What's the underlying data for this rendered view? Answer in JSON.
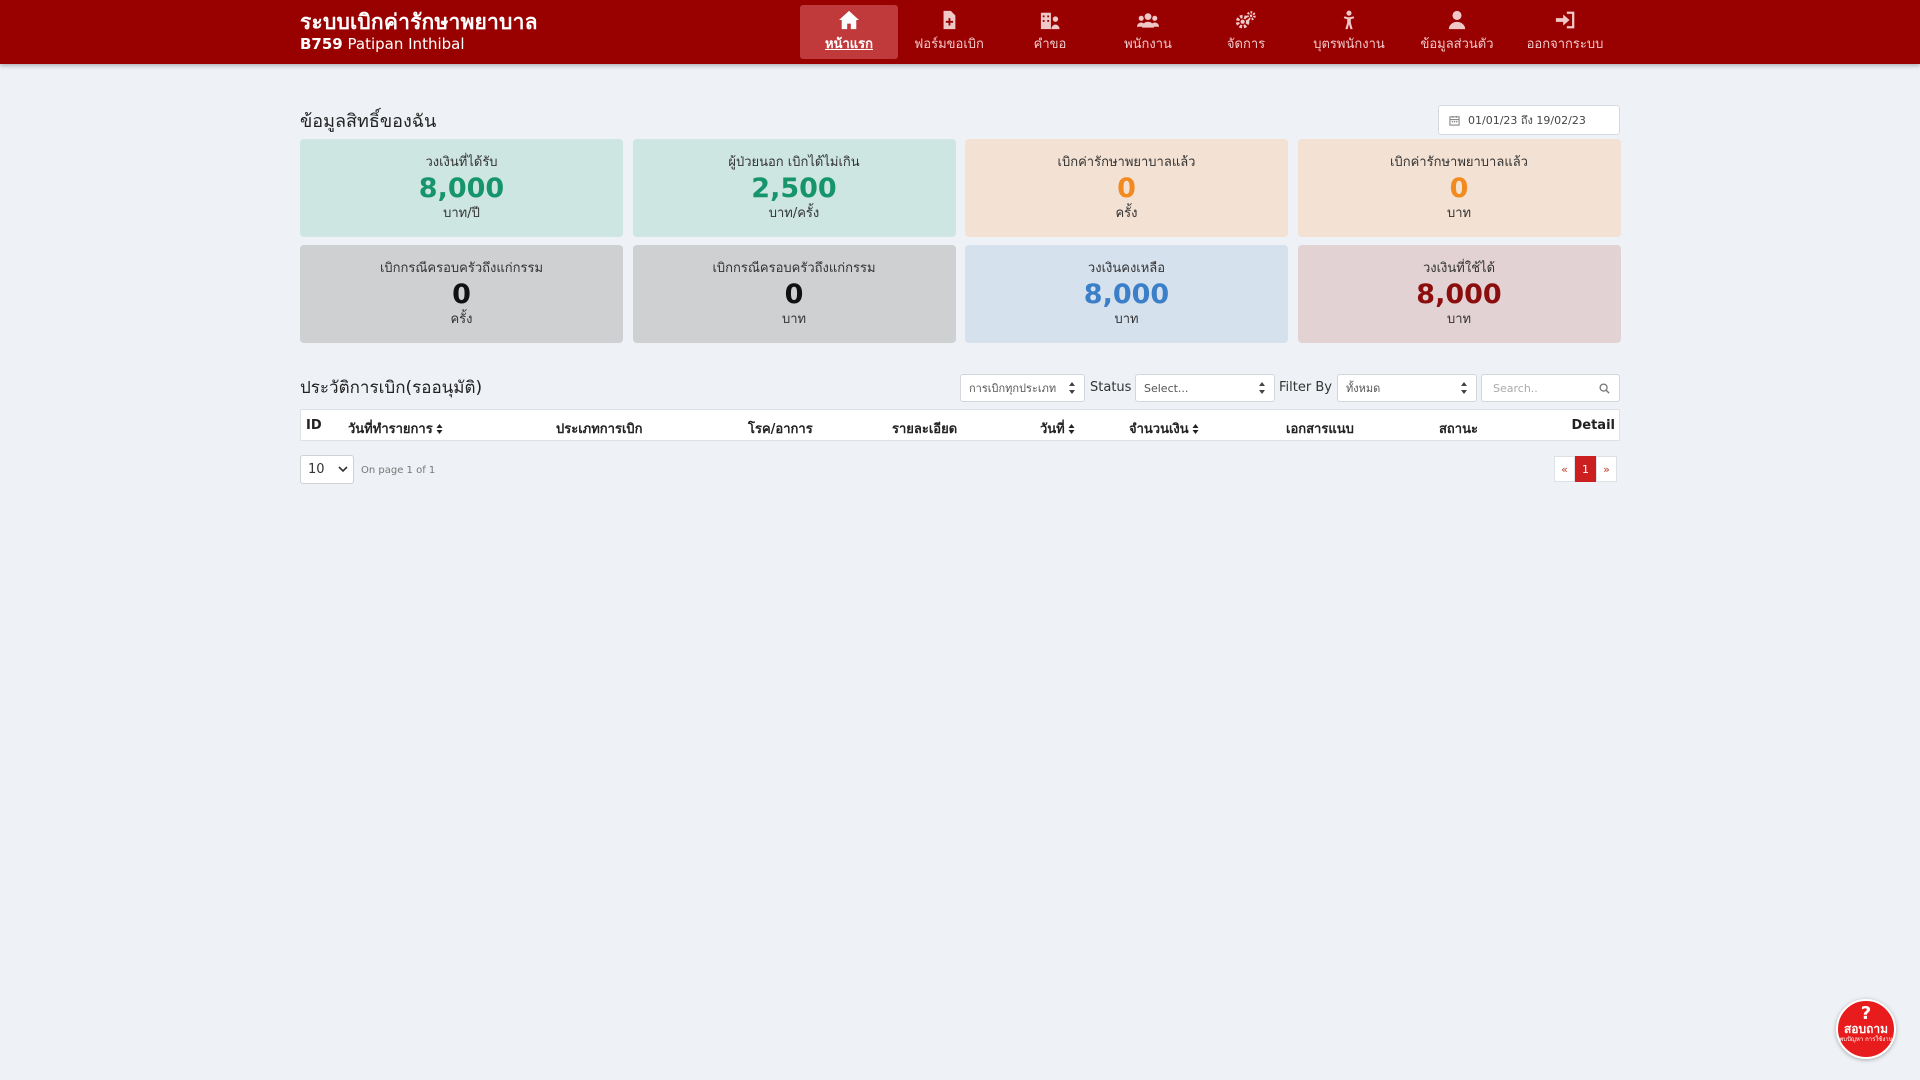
{
  "header": {
    "title": "ระบบเบิกค่ารักษาพยาบาล",
    "user_code": "B759",
    "user_name": "Patipan Inthibal"
  },
  "nav": [
    {
      "label": "หน้าแรก",
      "icon": "home-icon",
      "active": true
    },
    {
      "label": "ฟอร์มขอเบิก",
      "icon": "file-plus-icon"
    },
    {
      "label": "คำขอ",
      "icon": "building-user-icon"
    },
    {
      "label": "พนักงาน",
      "icon": "users-icon"
    },
    {
      "label": "จัดการ",
      "icon": "gears-icon"
    },
    {
      "label": "บุตรพนักงาน",
      "icon": "child-icon"
    },
    {
      "label": "ข้อมูลส่วนตัว",
      "icon": "user-icon"
    },
    {
      "label": "ออกจากระบบ",
      "icon": "sign-in-icon"
    }
  ],
  "rights": {
    "title": "ข้อมูลสิทธิ์ของฉัน",
    "date_range": "01/01/23 ถึง 19/02/23"
  },
  "cards": [
    {
      "label": "วงเงินที่ได้รับ",
      "value": "8,000",
      "unit": "บาท/ปี",
      "value_color": "#16956b"
    },
    {
      "label": "ผู้ป่วยนอก เบิกได้ไม่เกิน",
      "value": "2,500",
      "unit": "บาท/ครั้ง",
      "value_color": "#16956b"
    },
    {
      "label": "เบิกค่ารักษาพยาบาลแล้ว",
      "value": "0",
      "unit": "ครั้ง",
      "value_color": "#f28a1f"
    },
    {
      "label": "เบิกค่ารักษาพยาบาลแล้ว",
      "value": "0",
      "unit": "บาท",
      "value_color": "#f28a1f"
    },
    {
      "label": "เบิกกรณีครอบครัวถึงแก่กรรม",
      "value": "0",
      "unit": "ครั้ง",
      "value_color": "#111111"
    },
    {
      "label": "เบิกกรณีครอบครัวถึงแก่กรรม",
      "value": "0",
      "unit": "บาท",
      "value_color": "#111111"
    },
    {
      "label": "วงเงินคงเหลือ",
      "value": "8,000",
      "unit": "บาท",
      "value_color": "#3a7fc8"
    },
    {
      "label": "วงเงินที่ใช้ได้",
      "value": "8,000",
      "unit": "บาท",
      "value_color": "#8b0d0d"
    }
  ],
  "history": {
    "title": "ประวัติการเบิก(รออนุมัติ)",
    "type_filter": "การเบิกทุกประเภท",
    "status_label": "Status",
    "status_placeholder": "Select...",
    "filter_by_label": "Filter By",
    "filter_by_value": "ทั้งหมด",
    "search_placeholder": "Search..",
    "columns": [
      "ID",
      "วันที่ทำรายการ",
      "ประเภทการเบิก",
      "โรค/อาการ",
      "รายละเอียด",
      "วันที่",
      "จำนวนเงิน",
      "เอกสารแนบ",
      "สถานะ",
      "Detail"
    ]
  },
  "pagination": {
    "page_size": "10",
    "info": "On page 1 of 1",
    "prev": "«",
    "current": "1",
    "next": "»"
  },
  "help": {
    "mark": "?",
    "main": "สอบถาม",
    "sub": "พบปัญหา การใช้งาน"
  },
  "colors": {
    "topbar": "#990000",
    "nav_active": "#c0393b",
    "page_bg": "#eef1f5"
  }
}
